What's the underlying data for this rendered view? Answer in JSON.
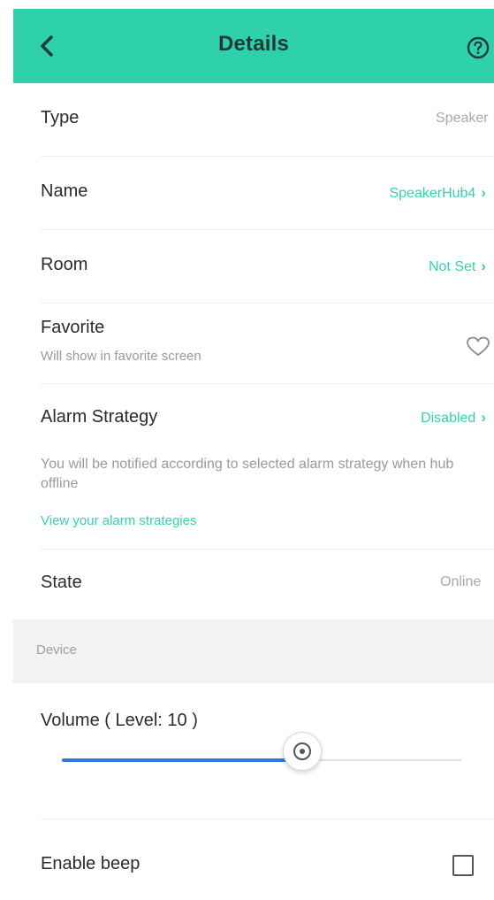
{
  "header": {
    "title": "Details",
    "back_icon": "chevron-left-icon",
    "help_icon": "help-circle-icon",
    "bg_color": "#2fd1ac"
  },
  "rows": {
    "type": {
      "label": "Type",
      "value": "Speaker"
    },
    "name": {
      "label": "Name",
      "value": "SpeakerHub4"
    },
    "room": {
      "label": "Room",
      "value": "Not Set"
    },
    "favorite": {
      "label": "Favorite",
      "sub": "Will show in favorite screen"
    },
    "alarm": {
      "label": "Alarm Strategy",
      "value": "Disabled",
      "description": "You will be notified according to selected alarm strategy when hub offline",
      "link": "View your alarm strategies"
    },
    "state": {
      "label": "State",
      "value": "Online"
    }
  },
  "device_section": {
    "label": "Device"
  },
  "volume": {
    "label": "Volume ( Level: 10 )",
    "level_fraction": 0.6
  },
  "beep": {
    "label": "Enable beep",
    "checked": false
  },
  "colors": {
    "accent": "#39cfae",
    "slider": "#2f7be0"
  }
}
